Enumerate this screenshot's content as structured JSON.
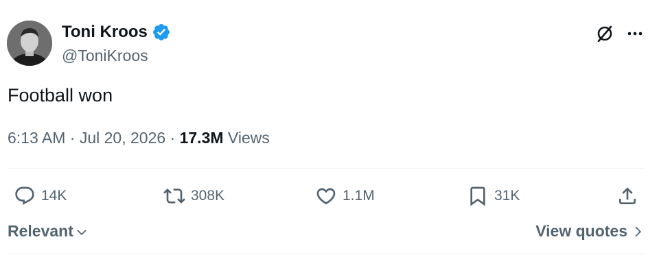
{
  "author": {
    "name": "Toni Kroos",
    "handle": "@ToniKroos",
    "verified_color": "#1d9bf0"
  },
  "icons": {
    "verified": "verified-badge-icon",
    "grok": "grok-icon",
    "more": "more-options-icon",
    "reply": "reply-icon",
    "retweet": "retweet-icon",
    "like": "heart-icon",
    "bookmark": "bookmark-icon",
    "share": "share-icon"
  },
  "tweet": {
    "text": "Football won",
    "time": "6:13 AM · Jul 20, 2026 · ",
    "views_count": "17.3M",
    "views_label": " Views"
  },
  "actions": {
    "replies": "14K",
    "retweets": "308K",
    "likes": "1.1M",
    "bookmarks": "31K"
  },
  "footer": {
    "sort_label": "Relevant",
    "view_quotes_label": "View quotes"
  },
  "colors": {
    "text_primary": "#0f1419",
    "text_secondary": "#536471",
    "divider": "#eff3f4",
    "accent": "#1d9bf0"
  }
}
